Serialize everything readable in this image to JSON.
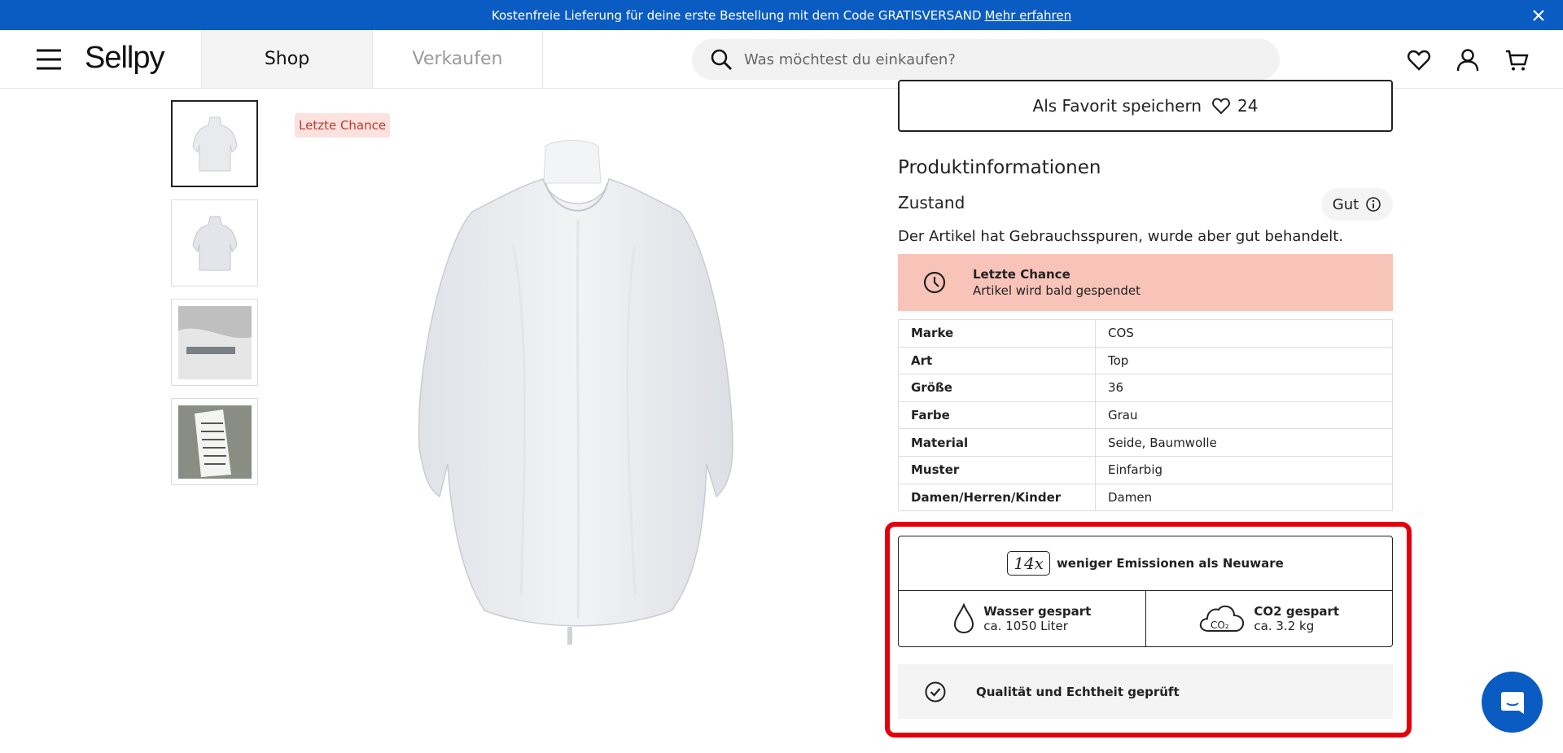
{
  "announcement": {
    "text": "Kostenfreie Lieferung für deine erste Bestellung mit dem Code GRATISVERSAND",
    "link": "Mehr erfahren"
  },
  "header": {
    "logo": "Sellpy",
    "tabs": {
      "shop": "Shop",
      "sell": "Verkaufen"
    },
    "search_placeholder": "Was möchtest du einkaufen?"
  },
  "product": {
    "badge": "Letzte Chance",
    "favorite_label": "Als Favorit speichern",
    "favorite_count": "24"
  },
  "info": {
    "title": "Produktinformationen",
    "condition_label": "Zustand",
    "condition_value": "Gut",
    "condition_desc": "Der Artikel hat Gebrauchsspuren, wurde aber gut behandelt.",
    "alert_title": "Letzte Chance",
    "alert_text": "Artikel wird bald gespendet",
    "specs": [
      {
        "key": "Marke",
        "value": "COS"
      },
      {
        "key": "Art",
        "value": "Top"
      },
      {
        "key": "Größe",
        "value": "36"
      },
      {
        "key": "Farbe",
        "value": "Grau"
      },
      {
        "key": "Material",
        "value": "Seide, Baumwolle"
      },
      {
        "key": "Muster",
        "value": "Einfarbig"
      },
      {
        "key": "Damen/Herren/Kinder",
        "value": "Damen"
      }
    ]
  },
  "sustainability": {
    "multiplier": "14x",
    "emissions_text": "weniger Emissionen als Neuware",
    "water_title": "Wasser gespart",
    "water_value": "ca. 1050 Liter",
    "co2_title": "CO2 gespart",
    "co2_value": "ca. 3.2 kg",
    "quality_text": "Qualität und Echtheit geprüft"
  },
  "colors": {
    "brand_blue": "#0a5cc2",
    "alert_bg": "#f8c3b9",
    "highlight_red": "#e3000b"
  },
  "icons": [
    "menu-icon",
    "search-icon",
    "heart-icon",
    "user-icon",
    "cart-icon",
    "close-icon",
    "clock-icon",
    "info-icon",
    "water-drop-icon",
    "co2-cloud-icon",
    "check-circle-icon",
    "chat-icon"
  ]
}
